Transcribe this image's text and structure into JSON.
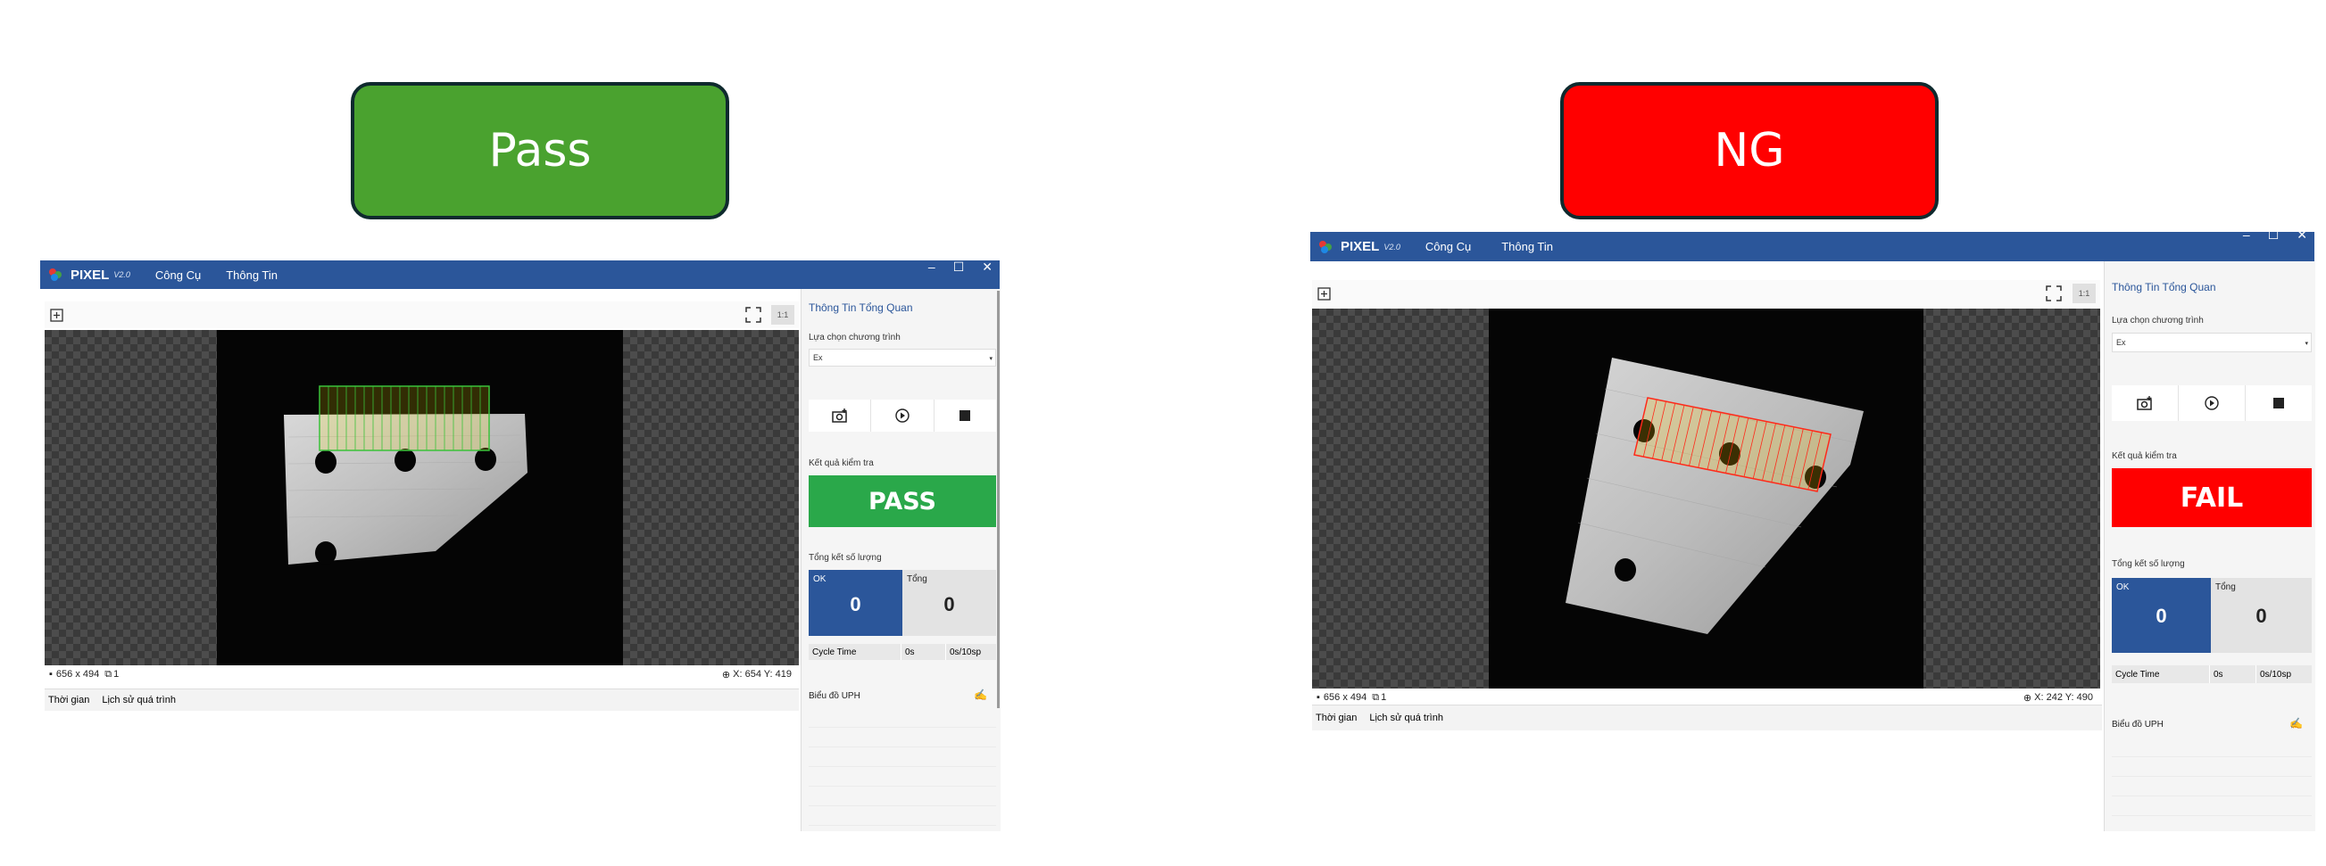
{
  "badges": {
    "pass_label": "Pass",
    "ng_label": "NG"
  },
  "app": {
    "brand": "PIXEL",
    "version": "V2.0",
    "menu": [
      "Công Cụ",
      "Thông Tin"
    ],
    "window_controls": [
      "–",
      "☐",
      "✕"
    ]
  },
  "panel": {
    "title": "Thông Tin Tổng Quan",
    "program_label": "Lựa chọn chương trình",
    "program_value": "Ex",
    "result_label": "Kết quả kiểm tra",
    "count_label": "Tổng kết số lượng",
    "ok_label": "OK",
    "total_label": "Tổng",
    "cycle_label": "Cycle Time",
    "uph_label": "Biểu đồ UPH"
  },
  "viewer": {
    "one_to_one": "1:1",
    "image_size": "656 x 494",
    "layer_count": "1"
  },
  "log": {
    "col_time": "Thời gian",
    "col_history": "Lịch sử quá trình"
  },
  "left": {
    "result": "PASS",
    "result_color": "#2aa84a",
    "ok_count": "0",
    "total_count": "0",
    "cycle_time": "0s",
    "cycle_rate": "0s/10sp",
    "coords": "X: 654 Y: 419"
  },
  "right": {
    "result": "FAIL",
    "result_color": "#ff0000",
    "ok_count": "0",
    "total_count": "0",
    "cycle_time": "0s",
    "cycle_rate": "0s/10sp",
    "coords": "X: 242 Y: 490"
  },
  "icons": [
    "add-image-icon",
    "fullscreen-icon",
    "capture-icon",
    "play-cycle-icon",
    "stop-icon",
    "image-size-icon",
    "layers-icon",
    "crosshair-icon",
    "chart-icon"
  ]
}
